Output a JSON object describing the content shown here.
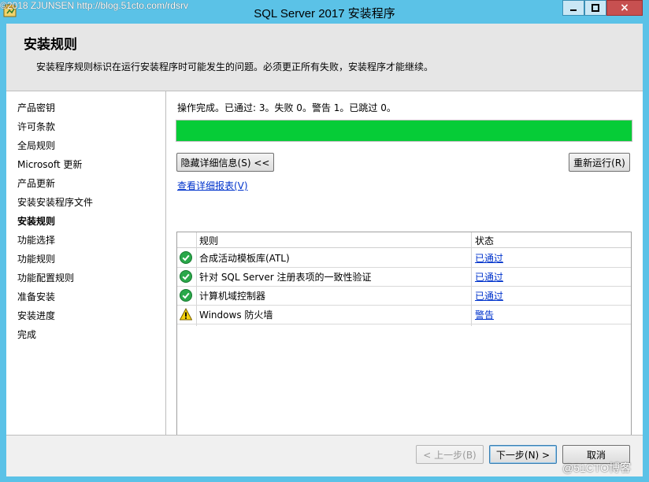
{
  "window": {
    "title": "SQL Server 2017 安装程序",
    "watermark_top": "©2018 ZJUNSEN http://blog.51cto.com/rdsrv",
    "watermark_bottom": "@51CTO博客",
    "close_glyph": "×"
  },
  "header": {
    "title": "安装规则",
    "description": "安装程序规则标识在运行安装程序时可能发生的问题。必须更正所有失败，安装程序才能继续。"
  },
  "nav": {
    "items": [
      {
        "label": "产品密钥"
      },
      {
        "label": "许可条款"
      },
      {
        "label": "全局规则"
      },
      {
        "label": "Microsoft 更新"
      },
      {
        "label": "产品更新"
      },
      {
        "label": "安装安装程序文件"
      },
      {
        "label": "安装规则",
        "active": true
      },
      {
        "label": "功能选择"
      },
      {
        "label": "功能规则"
      },
      {
        "label": "功能配置规则"
      },
      {
        "label": "准备安装"
      },
      {
        "label": "安装进度"
      },
      {
        "label": "完成"
      }
    ]
  },
  "main": {
    "status_text": "操作完成。已通过: 3。失败 0。警告 1。已跳过 0。",
    "progress_percent": 100,
    "progress_color": "#06cc37",
    "hide_details_label": "隐藏详细信息(S) <<",
    "rerun_label": "重新运行(R)",
    "view_report_label": "查看详细报表(V)",
    "table": {
      "columns": [
        "规则",
        "状态"
      ],
      "rows": [
        {
          "icon": "check-circle-icon",
          "rule": "合成活动模板库(ATL)",
          "status": "已通过"
        },
        {
          "icon": "check-circle-icon",
          "rule": "针对 SQL Server 注册表项的一致性验证",
          "status": "已通过"
        },
        {
          "icon": "check-circle-icon",
          "rule": "计算机域控制器",
          "status": "已通过"
        },
        {
          "icon": "warning-triangle-icon",
          "rule": "Windows 防火墙",
          "status": "警告"
        }
      ]
    }
  },
  "footer": {
    "back_label": "< 上一步(B)",
    "next_label": "下一步(N) >",
    "cancel_label": "取消"
  }
}
